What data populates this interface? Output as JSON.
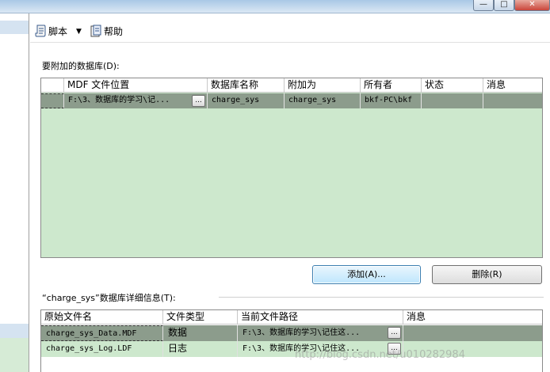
{
  "window": {
    "min_glyph": "—",
    "max_glyph": "□",
    "close_glyph": "✕"
  },
  "toolbar": {
    "script_label": "脚本",
    "help_label": "帮助",
    "dropdown_glyph": "▼"
  },
  "attach_section": {
    "label": "要附加的数据库(D):",
    "columns": [
      "MDF 文件位置",
      "数据库名称",
      "附加为",
      "所有者",
      "状态",
      "消息"
    ],
    "rows": [
      {
        "mdf_path": "F:\\3、数据库的学习\\记...",
        "db_name": "charge_sys",
        "attach_as": "charge_sys",
        "owner": "bkf-PC\\bkf",
        "status": "",
        "message": ""
      }
    ],
    "browse_glyph": "..."
  },
  "buttons": {
    "add": "添加(A)...",
    "remove": "删除(R)"
  },
  "detail_section": {
    "label": "“charge_sys”数据库详细信息(T):",
    "columns": [
      "原始文件名",
      "文件类型",
      "当前文件路径",
      "消息"
    ],
    "rows": [
      {
        "file_name": "charge_sys_Data.MDF",
        "file_type": "数据",
        "path": "F:\\3、数据库的学习\\记住这...",
        "message": ""
      },
      {
        "file_name": "charge_sys_Log.LDF",
        "file_type": "日志",
        "path": "F:\\3、数据库的学习\\记住这...",
        "message": ""
      }
    ]
  },
  "watermark": "http://blog.csdn.net/u010282984",
  "colors": {
    "row_selected": "#8c9c8c",
    "grid_background": "#cde8cd",
    "accent": "#3c7fb1"
  }
}
